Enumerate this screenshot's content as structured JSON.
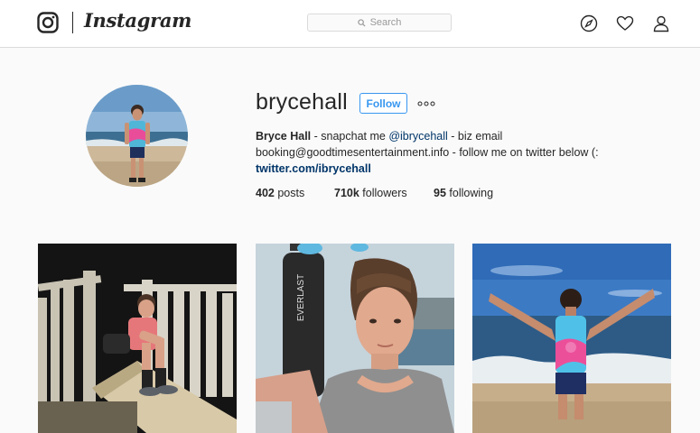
{
  "nav": {
    "wordmark": "Instagram",
    "search_placeholder": "Search"
  },
  "profile": {
    "username": "brycehall",
    "follow_label": "Follow",
    "full_name": "Bryce Hall",
    "bio_part1": " - snapchat me ",
    "bio_mention": "@ibrycehall",
    "bio_part2": " - biz email booking@goodtimesentertainment.info - follow me on twitter below (:",
    "external_link": "twitter.com/ibrycehall",
    "stats": {
      "posts_count": "402",
      "posts_label": "posts",
      "followers_count": "710k",
      "followers_label": "followers",
      "following_count": "95",
      "following_label": "following"
    }
  },
  "posts": [
    {
      "scene": "boy in pink shirt sitting on a slide at night"
    },
    {
      "scene": "selfie in grey tank top with punching bag"
    },
    {
      "scene": "boy in tie-dye tank with arms raised at the beach"
    }
  ],
  "colors": {
    "accent": "#3897f0",
    "link": "#003569",
    "border": "#dbdbdb",
    "background": "#fafafa"
  }
}
